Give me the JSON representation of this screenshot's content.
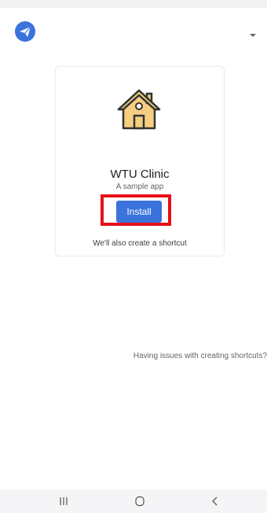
{
  "header": {
    "logo_icon": "paper-plane-icon",
    "dropdown_icon": "caret-down-icon"
  },
  "card": {
    "app_icon": "house-icon",
    "app_name": "WTU Clinic",
    "app_description": "A sample app",
    "install_label": "Install",
    "shortcut_note": "We'll also create a shortcut"
  },
  "help": {
    "link_text": "Having issues with creating shortcuts?"
  },
  "nav": {
    "recents_icon": "recents-icon",
    "home_icon": "home-icon",
    "back_icon": "back-icon"
  },
  "colors": {
    "accent": "#3a73dc",
    "highlight": "#e8101a",
    "house_outline": "#333333",
    "house_fill": "#f5cf7f"
  }
}
